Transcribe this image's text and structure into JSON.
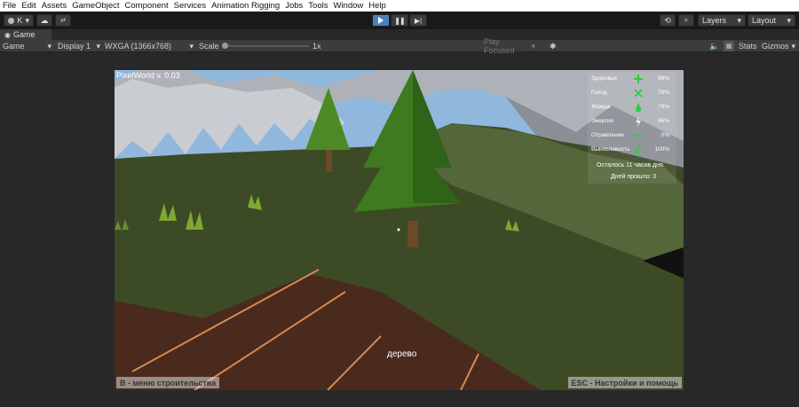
{
  "menu": [
    "File",
    "Edit",
    "Assets",
    "GameObject",
    "Component",
    "Services",
    "Animation Rigging",
    "Jobs",
    "Tools",
    "Window",
    "Help"
  ],
  "toolbar": {
    "account": "K",
    "layers": "Layers",
    "layout": "Layout"
  },
  "tab": {
    "label": "Game"
  },
  "controls": {
    "mode": "Game",
    "display": "Display 1",
    "resolution": "WXGA (1366x768)",
    "scale_label": "Scale",
    "scale_value": "1x",
    "play_focused": "Play Focused",
    "stats": "Stats",
    "gizmos": "Gizmos"
  },
  "game": {
    "version": "PixelWorld v. 0.03",
    "stats": [
      {
        "name": "Здоровье",
        "value": "98%",
        "icon": "plus-icon"
      },
      {
        "name": "Голод",
        "value": "79%",
        "icon": "crossed-utensils-icon"
      },
      {
        "name": "Жажда",
        "value": "79%",
        "icon": "drop-icon"
      },
      {
        "name": "Энергия",
        "value": "96%",
        "icon": "lightning-icon"
      },
      {
        "name": "Отравление",
        "value": "0%",
        "icon": "poison-icon"
      },
      {
        "name": "Выносливость",
        "value": "100%",
        "icon": "running-icon"
      }
    ],
    "time_left": "Осталось 11 часов дня.",
    "days_passed": "Дней прошло: 0",
    "target": "дерево",
    "build_menu": "B - меню строительства",
    "esc_help": "ESC - Настройки и помощь"
  },
  "colors": {
    "accent": "#4c7fbd",
    "stat_green": "#2ecc40"
  }
}
